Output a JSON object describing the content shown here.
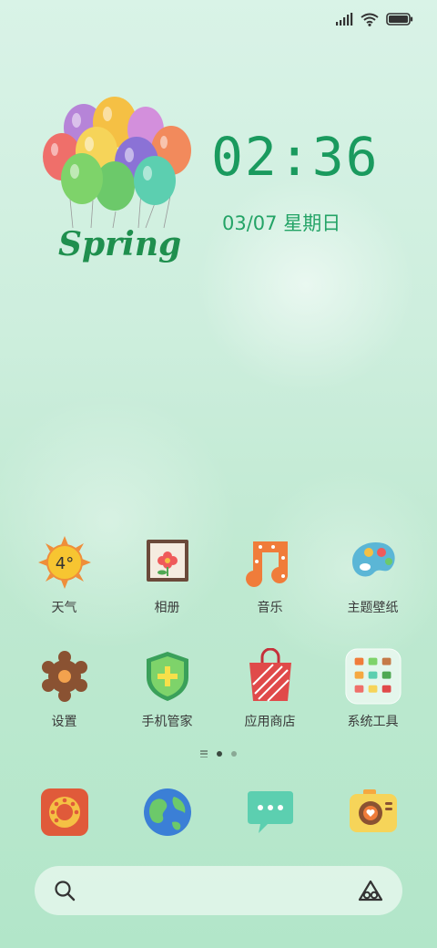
{
  "status_bar": {
    "icons": [
      "signal-icon",
      "wifi-icon",
      "battery-icon"
    ]
  },
  "wallpaper": {
    "art_text": "Spring"
  },
  "lockclock": {
    "time": "02:36",
    "date": "03/07 星期日"
  },
  "apps": [
    [
      {
        "label": "天气",
        "icon": "weather-icon",
        "badge": "4°"
      },
      {
        "label": "相册",
        "icon": "gallery-icon"
      },
      {
        "label": "音乐",
        "icon": "music-icon"
      },
      {
        "label": "主题壁纸",
        "icon": "theme-icon"
      }
    ],
    [
      {
        "label": "设置",
        "icon": "settings-icon"
      },
      {
        "label": "手机管家",
        "icon": "security-icon"
      },
      {
        "label": "应用商店",
        "icon": "app-store-icon"
      },
      {
        "label": "系统工具",
        "icon": "folder-icon"
      }
    ]
  ],
  "page_indicator": {
    "pages": 2,
    "current": 1
  },
  "dock": [
    {
      "icon": "phone-icon"
    },
    {
      "icon": "browser-icon"
    },
    {
      "icon": "messages-icon"
    },
    {
      "icon": "camera-icon"
    }
  ],
  "search_bar": {
    "left_icon": "search-icon",
    "right_icon": "assistant-icon"
  }
}
